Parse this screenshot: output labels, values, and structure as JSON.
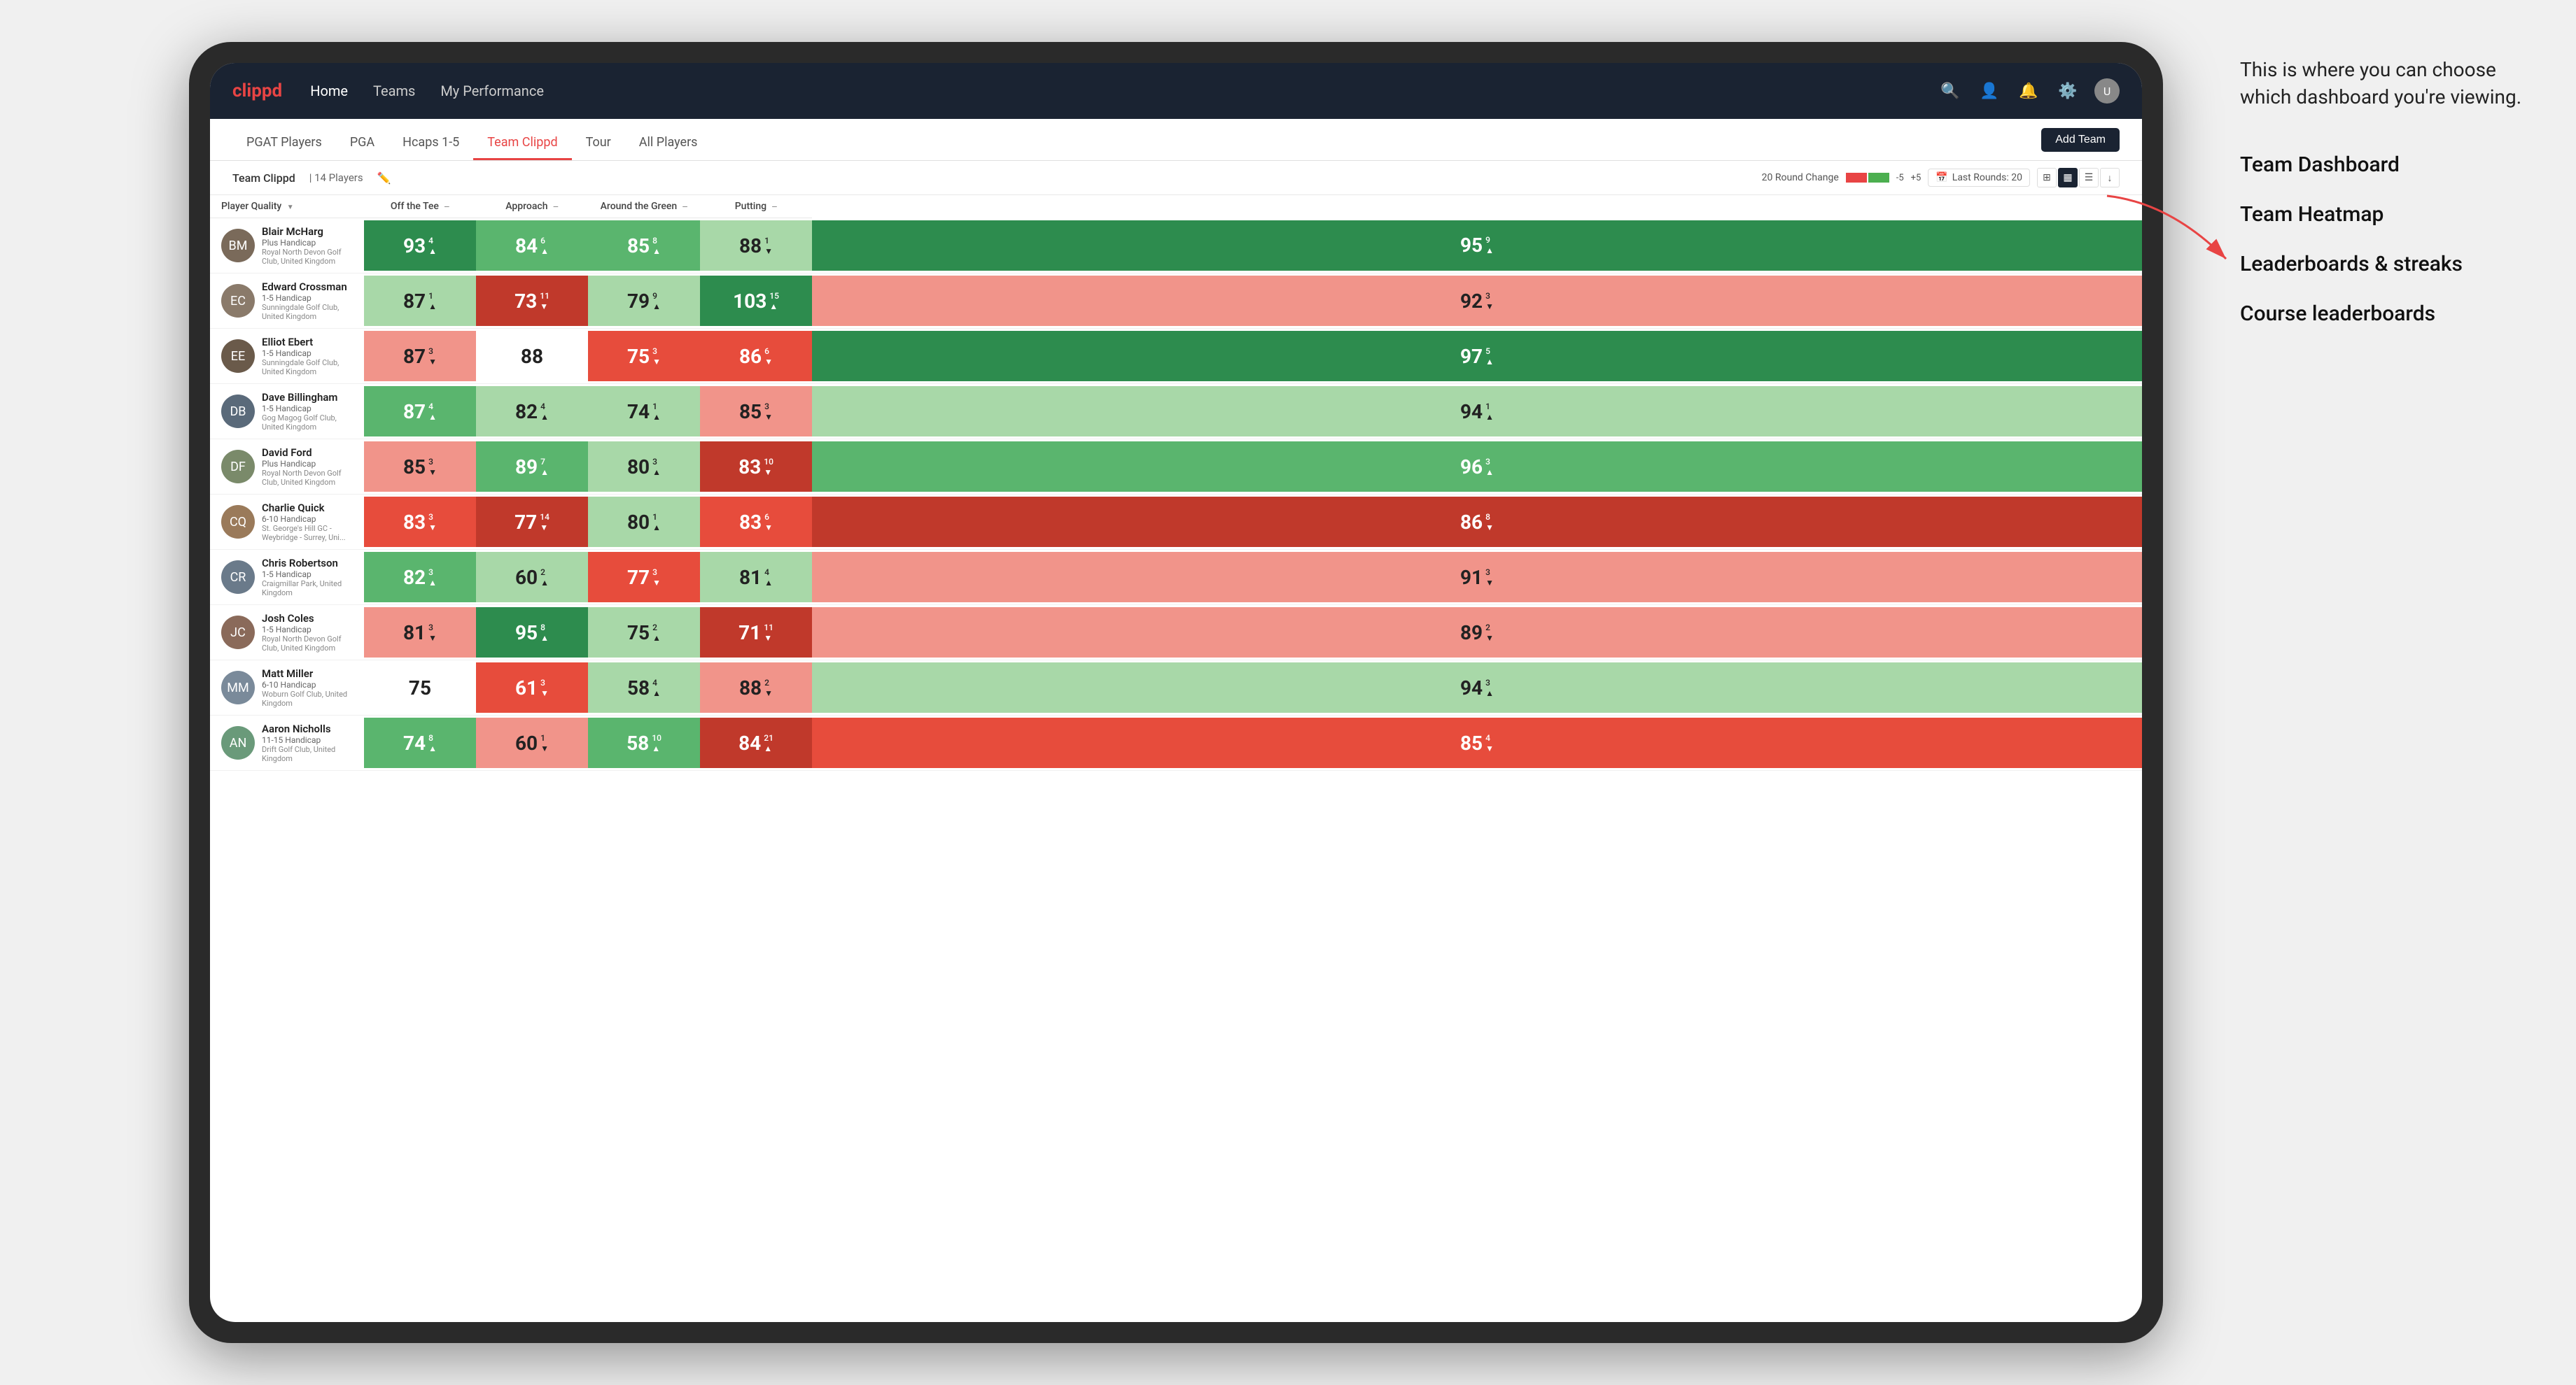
{
  "annotation": {
    "intro": "This is where you can choose which dashboard you're viewing.",
    "options": [
      "Team Dashboard",
      "Team Heatmap",
      "Leaderboards & streaks",
      "Course leaderboards"
    ]
  },
  "navbar": {
    "logo": "clippd",
    "items": [
      "Home",
      "Teams",
      "My Performance"
    ],
    "icons": [
      "search",
      "person",
      "bell",
      "settings",
      "avatar"
    ]
  },
  "subnav": {
    "tabs": [
      "PGAT Players",
      "PGA",
      "Hcaps 1-5",
      "Team Clippd",
      "Tour",
      "All Players"
    ],
    "active_tab": "Team Clippd",
    "add_team_label": "Add Team"
  },
  "team_header": {
    "title": "Team Clippd",
    "separator": "|",
    "count": "14 Players",
    "round_change_label": "20 Round Change",
    "change_neg": "-5",
    "change_pos": "+5",
    "last_rounds_label": "Last Rounds:",
    "last_rounds_value": "20"
  },
  "table": {
    "columns": {
      "player": "Player Quality",
      "off_tee": "Off the Tee",
      "approach": "Approach",
      "around_green": "Around the Green",
      "putting": "Putting"
    },
    "players": [
      {
        "name": "Blair McHarg",
        "handicap": "Plus Handicap",
        "club": "Royal North Devon Golf Club, United Kingdom",
        "initials": "BM",
        "color": "#7a6a5a",
        "quality": {
          "value": 93,
          "change": 4,
          "dir": "up",
          "bg": "green-dark"
        },
        "off_tee": {
          "value": 84,
          "change": 6,
          "dir": "up",
          "bg": "green-mid"
        },
        "approach": {
          "value": 85,
          "change": 8,
          "dir": "up",
          "bg": "green-mid"
        },
        "around_green": {
          "value": 88,
          "change": 1,
          "dir": "down",
          "bg": "green-light"
        },
        "putting": {
          "value": 95,
          "change": 9,
          "dir": "up",
          "bg": "green-dark"
        }
      },
      {
        "name": "Edward Crossman",
        "handicap": "1-5 Handicap",
        "club": "Sunningdale Golf Club, United Kingdom",
        "initials": "EC",
        "color": "#8a7a6a",
        "quality": {
          "value": 87,
          "change": 1,
          "dir": "up",
          "bg": "green-light"
        },
        "off_tee": {
          "value": 73,
          "change": 11,
          "dir": "down",
          "bg": "red-dark"
        },
        "approach": {
          "value": 79,
          "change": 9,
          "dir": "up",
          "bg": "green-light"
        },
        "around_green": {
          "value": 103,
          "change": 15,
          "dir": "up",
          "bg": "green-dark"
        },
        "putting": {
          "value": 92,
          "change": 3,
          "dir": "down",
          "bg": "red-light"
        }
      },
      {
        "name": "Elliot Ebert",
        "handicap": "1-5 Handicap",
        "club": "Sunningdale Golf Club, United Kingdom",
        "initials": "EE",
        "color": "#6a5a4a",
        "quality": {
          "value": 87,
          "change": 3,
          "dir": "down",
          "bg": "red-light"
        },
        "off_tee": {
          "value": 88,
          "change": 0,
          "dir": "none",
          "bg": "neutral"
        },
        "approach": {
          "value": 75,
          "change": 3,
          "dir": "down",
          "bg": "red-mid"
        },
        "around_green": {
          "value": 86,
          "change": 6,
          "dir": "down",
          "bg": "red-mid"
        },
        "putting": {
          "value": 97,
          "change": 5,
          "dir": "up",
          "bg": "green-dark"
        }
      },
      {
        "name": "Dave Billingham",
        "handicap": "1-5 Handicap",
        "club": "Gog Magog Golf Club, United Kingdom",
        "initials": "DB",
        "color": "#5a6a7a",
        "quality": {
          "value": 87,
          "change": 4,
          "dir": "up",
          "bg": "green-mid"
        },
        "off_tee": {
          "value": 82,
          "change": 4,
          "dir": "up",
          "bg": "green-light"
        },
        "approach": {
          "value": 74,
          "change": 1,
          "dir": "up",
          "bg": "green-light"
        },
        "around_green": {
          "value": 85,
          "change": 3,
          "dir": "down",
          "bg": "red-light"
        },
        "putting": {
          "value": 94,
          "change": 1,
          "dir": "up",
          "bg": "green-light"
        }
      },
      {
        "name": "David Ford",
        "handicap": "Plus Handicap",
        "club": "Royal North Devon Golf Club, United Kingdom",
        "initials": "DF",
        "color": "#7a8a6a",
        "quality": {
          "value": 85,
          "change": 3,
          "dir": "down",
          "bg": "red-light"
        },
        "off_tee": {
          "value": 89,
          "change": 7,
          "dir": "up",
          "bg": "green-mid"
        },
        "approach": {
          "value": 80,
          "change": 3,
          "dir": "up",
          "bg": "green-light"
        },
        "around_green": {
          "value": 83,
          "change": 10,
          "dir": "down",
          "bg": "red-dark"
        },
        "putting": {
          "value": 96,
          "change": 3,
          "dir": "up",
          "bg": "green-mid"
        }
      },
      {
        "name": "Charlie Quick",
        "handicap": "6-10 Handicap",
        "club": "St. George's Hill GC - Weybridge - Surrey, Uni...",
        "initials": "CQ",
        "color": "#9a7a5a",
        "quality": {
          "value": 83,
          "change": 3,
          "dir": "down",
          "bg": "red-mid"
        },
        "off_tee": {
          "value": 77,
          "change": 14,
          "dir": "down",
          "bg": "red-dark"
        },
        "approach": {
          "value": 80,
          "change": 1,
          "dir": "up",
          "bg": "green-light"
        },
        "around_green": {
          "value": 83,
          "change": 6,
          "dir": "down",
          "bg": "red-mid"
        },
        "putting": {
          "value": 86,
          "change": 8,
          "dir": "down",
          "bg": "red-dark"
        }
      },
      {
        "name": "Chris Robertson",
        "handicap": "1-5 Handicap",
        "club": "Craigmillar Park, United Kingdom",
        "initials": "CR",
        "color": "#6a7a8a",
        "quality": {
          "value": 82,
          "change": 3,
          "dir": "up",
          "bg": "green-mid"
        },
        "off_tee": {
          "value": 60,
          "change": 2,
          "dir": "up",
          "bg": "green-light"
        },
        "approach": {
          "value": 77,
          "change": 3,
          "dir": "down",
          "bg": "red-mid"
        },
        "around_green": {
          "value": 81,
          "change": 4,
          "dir": "up",
          "bg": "green-light"
        },
        "putting": {
          "value": 91,
          "change": 3,
          "dir": "down",
          "bg": "red-light"
        }
      },
      {
        "name": "Josh Coles",
        "handicap": "1-5 Handicap",
        "club": "Royal North Devon Golf Club, United Kingdom",
        "initials": "JC",
        "color": "#8a6a5a",
        "quality": {
          "value": 81,
          "change": 3,
          "dir": "down",
          "bg": "red-light"
        },
        "off_tee": {
          "value": 95,
          "change": 8,
          "dir": "up",
          "bg": "green-dark"
        },
        "approach": {
          "value": 75,
          "change": 2,
          "dir": "up",
          "bg": "green-light"
        },
        "around_green": {
          "value": 71,
          "change": 11,
          "dir": "down",
          "bg": "red-dark"
        },
        "putting": {
          "value": 89,
          "change": 2,
          "dir": "down",
          "bg": "red-light"
        }
      },
      {
        "name": "Matt Miller",
        "handicap": "6-10 Handicap",
        "club": "Woburn Golf Club, United Kingdom",
        "initials": "MM",
        "color": "#7a8a9a",
        "quality": {
          "value": 75,
          "change": 0,
          "dir": "none",
          "bg": "neutral"
        },
        "off_tee": {
          "value": 61,
          "change": 3,
          "dir": "down",
          "bg": "red-mid"
        },
        "approach": {
          "value": 58,
          "change": 4,
          "dir": "up",
          "bg": "green-light"
        },
        "around_green": {
          "value": 88,
          "change": 2,
          "dir": "down",
          "bg": "red-light"
        },
        "putting": {
          "value": 94,
          "change": 3,
          "dir": "up",
          "bg": "green-light"
        }
      },
      {
        "name": "Aaron Nicholls",
        "handicap": "11-15 Handicap",
        "club": "Drift Golf Club, United Kingdom",
        "initials": "AN",
        "color": "#6a9a7a",
        "quality": {
          "value": 74,
          "change": 8,
          "dir": "up",
          "bg": "green-mid"
        },
        "off_tee": {
          "value": 60,
          "change": 1,
          "dir": "down",
          "bg": "red-light"
        },
        "approach": {
          "value": 58,
          "change": 10,
          "dir": "up",
          "bg": "green-mid"
        },
        "around_green": {
          "value": 84,
          "change": 21,
          "dir": "up",
          "bg": "red-dark"
        },
        "putting": {
          "value": 85,
          "change": 4,
          "dir": "down",
          "bg": "red-mid"
        }
      }
    ]
  }
}
